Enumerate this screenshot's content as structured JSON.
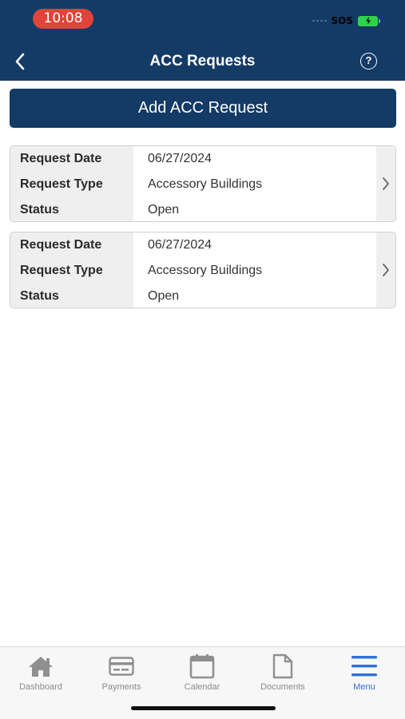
{
  "status_bar": {
    "time": "10:08",
    "carrier": "SOS",
    "battery_color": "#2fd24a"
  },
  "header": {
    "title": "ACC Requests",
    "back_icon": "chevron-left-icon",
    "help_icon": "question-circle-icon",
    "help_glyph": "?",
    "background": "#143a66"
  },
  "actions": {
    "add_label": "Add ACC Request"
  },
  "requests": [
    {
      "labels": {
        "date": "Request Date",
        "type": "Request Type",
        "status": "Status"
      },
      "date": "06/27/2024",
      "type": "Accessory Buildings",
      "status": "Open"
    },
    {
      "labels": {
        "date": "Request Date",
        "type": "Request Type",
        "status": "Status"
      },
      "date": "06/27/2024",
      "type": "Accessory Buildings",
      "status": "Open"
    }
  ],
  "tabbar": {
    "items": [
      {
        "label": "Dashboard",
        "icon": "home-icon"
      },
      {
        "label": "Payments",
        "icon": "credit-card-icon"
      },
      {
        "label": "Calendar",
        "icon": "calendar-icon"
      },
      {
        "label": "Documents",
        "icon": "document-icon"
      },
      {
        "label": "Menu",
        "icon": "menu-icon",
        "active": true
      }
    ],
    "active_color": "#2f6fd8"
  }
}
